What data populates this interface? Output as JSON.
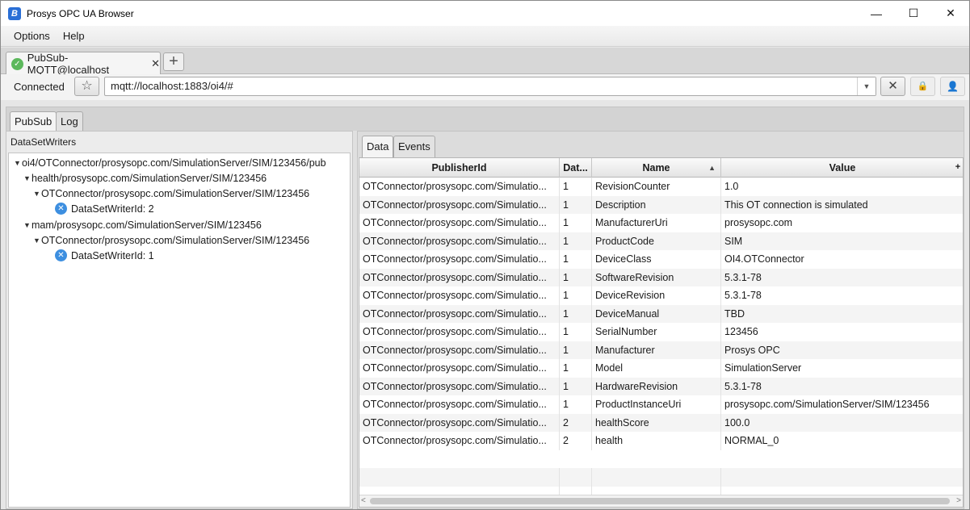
{
  "window": {
    "title": "Prosys OPC UA Browser",
    "app_icon_letter": "B",
    "minimize_glyph": "—",
    "maximize_glyph": "☐",
    "close_glyph": "✕"
  },
  "menu": {
    "items": [
      "Options",
      "Help"
    ]
  },
  "connection_tab": {
    "label": "PubSub-MQTT@localhost",
    "status_icon": "check-circle-icon",
    "status_glyph": "✓",
    "close_glyph": "✕",
    "add_glyph": "+"
  },
  "address_bar": {
    "status": "Connected",
    "url": "mqtt://localhost:1883/oi4/#",
    "star_glyph": "☆",
    "dropdown_glyph": "▼",
    "disconnect_glyph": "✕",
    "lock_glyph": "🔒",
    "user_glyph": "👤"
  },
  "inner_tabs": [
    "PubSub",
    "Log"
  ],
  "left_pane": {
    "title": "DataSetWriters",
    "tree": [
      {
        "label": "oi4/OTConnector/prosysopc.com/SimulationServer/SIM/123456/pub",
        "level": 0,
        "expanded": true,
        "leaf": false
      },
      {
        "label": "health/prosysopc.com/SimulationServer/SIM/123456",
        "level": 1,
        "expanded": true,
        "leaf": false
      },
      {
        "label": "OTConnector/prosysopc.com/SimulationServer/SIM/123456",
        "level": 2,
        "expanded": true,
        "leaf": false
      },
      {
        "label": "DataSetWriterId: 2",
        "level": 3,
        "leaf": true
      },
      {
        "label": "mam/prosysopc.com/SimulationServer/SIM/123456",
        "level": 1,
        "expanded": true,
        "leaf": false
      },
      {
        "label": "OTConnector/prosysopc.com/SimulationServer/SIM/123456",
        "level": 2,
        "expanded": true,
        "leaf": false
      },
      {
        "label": "DataSetWriterId: 1",
        "level": 3,
        "leaf": true
      }
    ],
    "expand_glyph": "▼",
    "writer_icon_glyph": "✕"
  },
  "right_pane": {
    "tabs": [
      "Data",
      "Events"
    ],
    "columns": [
      "PublisherId",
      "Dat...",
      "Name",
      "Value"
    ],
    "sort_glyph": "▲",
    "column_menu_glyph": "+",
    "rows": [
      [
        "OTConnector/prosysopc.com/Simulatio...",
        "1",
        "RevisionCounter",
        "1.0"
      ],
      [
        "OTConnector/prosysopc.com/Simulatio...",
        "1",
        "Description",
        "This OT connection is simulated"
      ],
      [
        "OTConnector/prosysopc.com/Simulatio...",
        "1",
        "ManufacturerUri",
        "prosysopc.com"
      ],
      [
        "OTConnector/prosysopc.com/Simulatio...",
        "1",
        "ProductCode",
        "SIM"
      ],
      [
        "OTConnector/prosysopc.com/Simulatio...",
        "1",
        "DeviceClass",
        "OI4.OTConnector"
      ],
      [
        "OTConnector/prosysopc.com/Simulatio...",
        "1",
        "SoftwareRevision",
        "5.3.1-78"
      ],
      [
        "OTConnector/prosysopc.com/Simulatio...",
        "1",
        "DeviceRevision",
        "5.3.1-78"
      ],
      [
        "OTConnector/prosysopc.com/Simulatio...",
        "1",
        "DeviceManual",
        "TBD"
      ],
      [
        "OTConnector/prosysopc.com/Simulatio...",
        "1",
        "SerialNumber",
        "123456"
      ],
      [
        "OTConnector/prosysopc.com/Simulatio...",
        "1",
        "Manufacturer",
        "Prosys OPC"
      ],
      [
        "OTConnector/prosysopc.com/Simulatio...",
        "1",
        "Model",
        "SimulationServer"
      ],
      [
        "OTConnector/prosysopc.com/Simulatio...",
        "1",
        "HardwareRevision",
        "5.3.1-78"
      ],
      [
        "OTConnector/prosysopc.com/Simulatio...",
        "1",
        "ProductInstanceUri",
        "prosysopc.com/SimulationServer/SIM/123456"
      ],
      [
        "OTConnector/prosysopc.com/Simulatio...",
        "2",
        "healthScore",
        "100.0"
      ],
      [
        "OTConnector/prosysopc.com/Simulatio...",
        "2",
        "health",
        "NORMAL_0"
      ]
    ],
    "scroll_left_glyph": "<",
    "scroll_right_glyph": ">"
  }
}
